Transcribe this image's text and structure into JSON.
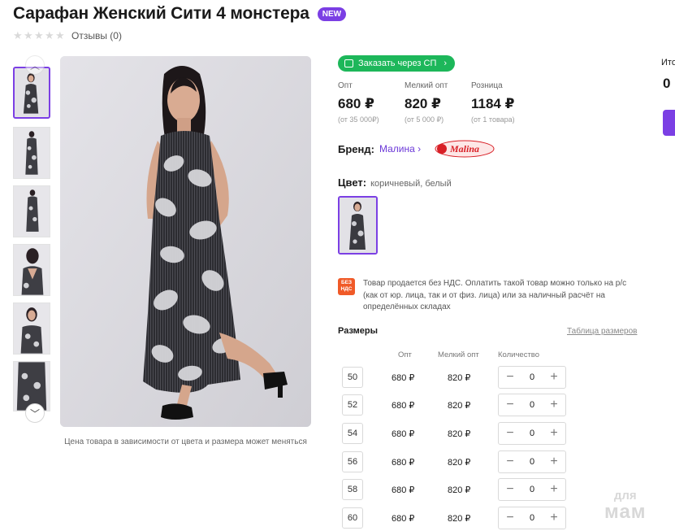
{
  "product": {
    "title": "Сарафан Женский Сити 4 монстера",
    "badge": "NEW",
    "reviews_label": "Отзывы (0)",
    "rating": 0,
    "rating_max": 5
  },
  "gallery": {
    "photo_note": "Цена товара в зависимости от цвета и размера может меняться",
    "thumb_count": 6,
    "active_thumb": 0
  },
  "order": {
    "sp_button_label": "Заказать через СП"
  },
  "prices": [
    {
      "label": "Опт",
      "value": "680 ₽",
      "note": "(от 35 000₽)"
    },
    {
      "label": "Мелкий опт",
      "value": "820 ₽",
      "note": "(от 5 000 ₽)"
    },
    {
      "label": "Розница",
      "value": "1184 ₽",
      "note": "(от 1 товара)"
    }
  ],
  "brand": {
    "label": "Бренд:",
    "name": "Малина",
    "logo_text": "Malina"
  },
  "color": {
    "label": "Цвет:",
    "value": "коричневый, белый"
  },
  "vat": {
    "icon_text_1": "БЕЗ",
    "icon_text_2": "НДС",
    "text": "Товар продается без НДС. Оплатить такой товар можно только на р/с (как от юр. лица, так и от физ. лица) или за наличный расчёт на определённых складах"
  },
  "sizes": {
    "title": "Размеры",
    "table_link": "Таблица размеров",
    "headers": {
      "opt": "Опт",
      "small_opt": "Мелкий опт",
      "qty": "Количество"
    },
    "rows": [
      {
        "size": "50",
        "opt": "680 ₽",
        "small_opt": "820 ₽",
        "qty": "0"
      },
      {
        "size": "52",
        "opt": "680 ₽",
        "small_opt": "820 ₽",
        "qty": "0"
      },
      {
        "size": "54",
        "opt": "680 ₽",
        "small_opt": "820 ₽",
        "qty": "0"
      },
      {
        "size": "56",
        "opt": "680 ₽",
        "small_opt": "820 ₽",
        "qty": "0"
      },
      {
        "size": "58",
        "opt": "680 ₽",
        "small_opt": "820 ₽",
        "qty": "0"
      },
      {
        "size": "60",
        "opt": "680 ₽",
        "small_opt": "820 ₽",
        "qty": "0"
      }
    ]
  },
  "summary": {
    "label_cut": "Ито",
    "value": "0"
  },
  "watermark": {
    "line1": "для",
    "line2": "мам"
  },
  "colors": {
    "accent": "#7b3fe4",
    "green": "#1db75a",
    "vat_orange": "#f05a28"
  }
}
